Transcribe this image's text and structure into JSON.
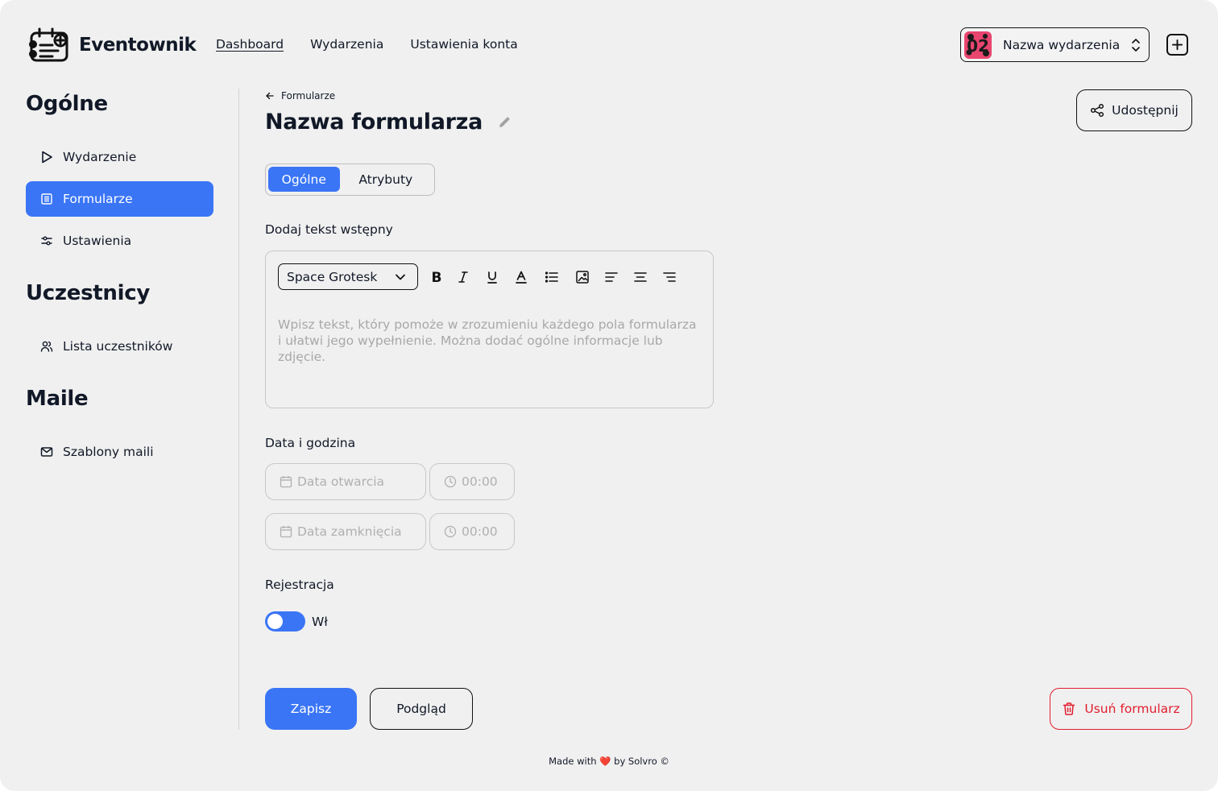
{
  "app": {
    "name": "Eventownik"
  },
  "topnav": [
    {
      "label": "Dashboard",
      "active": true
    },
    {
      "label": "Wydarzenia",
      "active": false
    },
    {
      "label": "Ustawienia konta",
      "active": false
    }
  ],
  "event_selector": {
    "name": "Nazwa wydarzenia",
    "thumbnail_text": "02"
  },
  "sidebar": {
    "sections": [
      {
        "title": "Ogólne",
        "items": [
          {
            "label": "Wydarzenie",
            "icon": "play-icon",
            "active": false
          },
          {
            "label": "Formularze",
            "icon": "form-icon",
            "active": true
          },
          {
            "label": "Ustawienia",
            "icon": "sliders-icon",
            "active": false
          }
        ]
      },
      {
        "title": "Uczestnicy",
        "items": [
          {
            "label": "Lista uczestników",
            "icon": "users-icon",
            "active": false
          }
        ]
      },
      {
        "title": "Maile",
        "items": [
          {
            "label": "Szablony maili",
            "icon": "mail-icon",
            "active": false
          }
        ]
      }
    ]
  },
  "main": {
    "breadcrumb": "Formularze",
    "title": "Nazwa formularza",
    "share_label": "Udostępnij",
    "tabs": [
      {
        "label": "Ogólne",
        "active": true
      },
      {
        "label": "Atrybuty",
        "active": false
      }
    ],
    "intro_label": "Dodaj tekst wstępny",
    "editor": {
      "font": "Space Grotesk",
      "placeholder": "Wpisz tekst, który pomoże w zrozumieniu każdego pola formularza i ułatwi jego wypełnienie. Można dodać ogólne informacje lub zdjęcie."
    },
    "datetime_label": "Data i godzina",
    "open_date_placeholder": "Data otwarcia",
    "open_time_placeholder": "00:00",
    "close_date_placeholder": "Data zamknięcia",
    "close_time_placeholder": "00:00",
    "registration_label": "Rejestracja",
    "registration_toggle": "Wł",
    "save_label": "Zapisz",
    "preview_label": "Podgląd",
    "delete_label": "Usuń formularz"
  },
  "footer": {
    "prefix": "Made with",
    "heart": "❤️",
    "suffix": "by Solvro ©"
  },
  "colors": {
    "accent": "#3a75f6",
    "danger": "#e11d2e",
    "background": "#f0f0f0"
  }
}
